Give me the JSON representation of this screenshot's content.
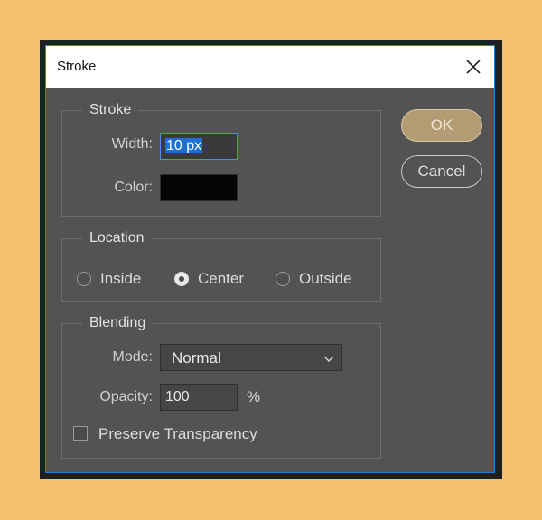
{
  "dialog": {
    "title": "Stroke"
  },
  "stroke": {
    "legend": "Stroke",
    "width_label": "Width:",
    "width_value": "10 px",
    "color_label": "Color:",
    "color_value": "#050505"
  },
  "location": {
    "legend": "Location",
    "options": [
      {
        "label": "Inside",
        "checked": false
      },
      {
        "label": "Center",
        "checked": true
      },
      {
        "label": "Outside",
        "checked": false
      }
    ]
  },
  "blending": {
    "legend": "Blending",
    "mode_label": "Mode:",
    "mode_value": "Normal",
    "opacity_label": "Opacity:",
    "opacity_value": "100",
    "opacity_unit": "%",
    "preserve_label": "Preserve Transparency",
    "preserve_checked": false
  },
  "buttons": {
    "ok_label": "OK",
    "cancel_label": "Cancel"
  },
  "colors": {
    "background": "#f6c16f",
    "dialog": "#535353",
    "accent": "#2e7ad1",
    "ok_button": "#b39b73"
  }
}
